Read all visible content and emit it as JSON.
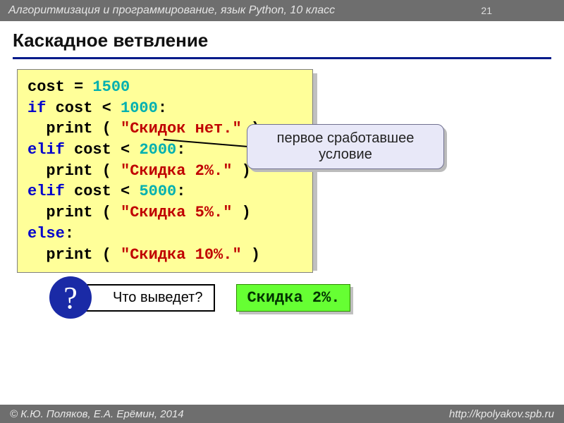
{
  "header": {
    "course": "Алгоритмизация и программирование, язык Python, 10 класс",
    "page_number": "21"
  },
  "title": "Каскадное ветвление",
  "code": {
    "l1_a": "cost = ",
    "l1_n": "1500",
    "l2_kw": "if",
    "l2_a": " cost < ",
    "l2_n": "1000",
    "l2_b": ":",
    "l3_a": "  print ( ",
    "l3_s": "\"Скидок нет.\"",
    "l3_b": " )",
    "l4_kw": "elif",
    "l4_a": " cost < ",
    "l4_n": "2000",
    "l4_b": ":",
    "l5_a": "  print ( ",
    "l5_s": "\"Скидка 2%.\"",
    "l5_b": " )",
    "l6_kw": "elif",
    "l6_a": " cost < ",
    "l6_n": "5000",
    "l6_b": ":",
    "l7_a": "  print ( ",
    "l7_s": "\"Скидка 5%.\"",
    "l7_b": " )",
    "l8_kw": "else",
    "l8_b": ":",
    "l9_a": "  print ( ",
    "l9_s": "\"Скидка 10%.\"",
    "l9_b": " )"
  },
  "callout": "первое сработавшее условие",
  "question": {
    "badge": "?",
    "label": "Что выведет?",
    "answer": "Скидка 2%."
  },
  "footer": {
    "copyright": "© К.Ю. Поляков, Е.А. Ерёмин, 2014",
    "url": "http://kpolyakov.spb.ru"
  }
}
